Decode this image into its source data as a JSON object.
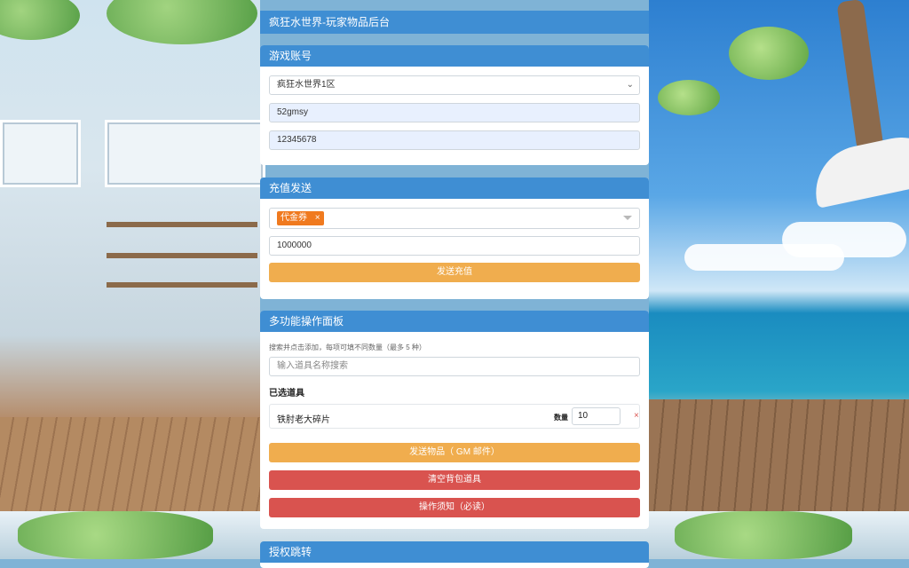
{
  "header": {
    "title": "疯狂水世界-玩家物品后台"
  },
  "account": {
    "heading": "游戏账号",
    "server_selected": "疯狂水世界1区",
    "username": "52gmsy",
    "password": "12345678"
  },
  "recharge": {
    "heading": "充值发送",
    "selected_tag": "代金券",
    "tag_remove": "×",
    "amount": "1000000",
    "send_button": "发送充值"
  },
  "multi": {
    "heading": "多功能操作面板",
    "hint": "搜索并点击添加，每项可填不同数量（最多 5 种）",
    "search_placeholder": "输入道具名称搜索",
    "selected_title": "已选道具",
    "items": [
      {
        "name": "铁肘老大碎片",
        "qty_label": "数量",
        "qty": "10",
        "remove": "×"
      }
    ],
    "send_items_button": "发送物品（ GM 邮件）",
    "clear_bag_button": "清空背包道具",
    "notice_button": "操作须知（必读）"
  },
  "auth": {
    "heading": "授权跳转"
  },
  "colors": {
    "header_blue": "#3f8ed3",
    "button_orange": "#f0ad4e",
    "button_red": "#d9534f",
    "tag_orange": "#f07a1f"
  }
}
